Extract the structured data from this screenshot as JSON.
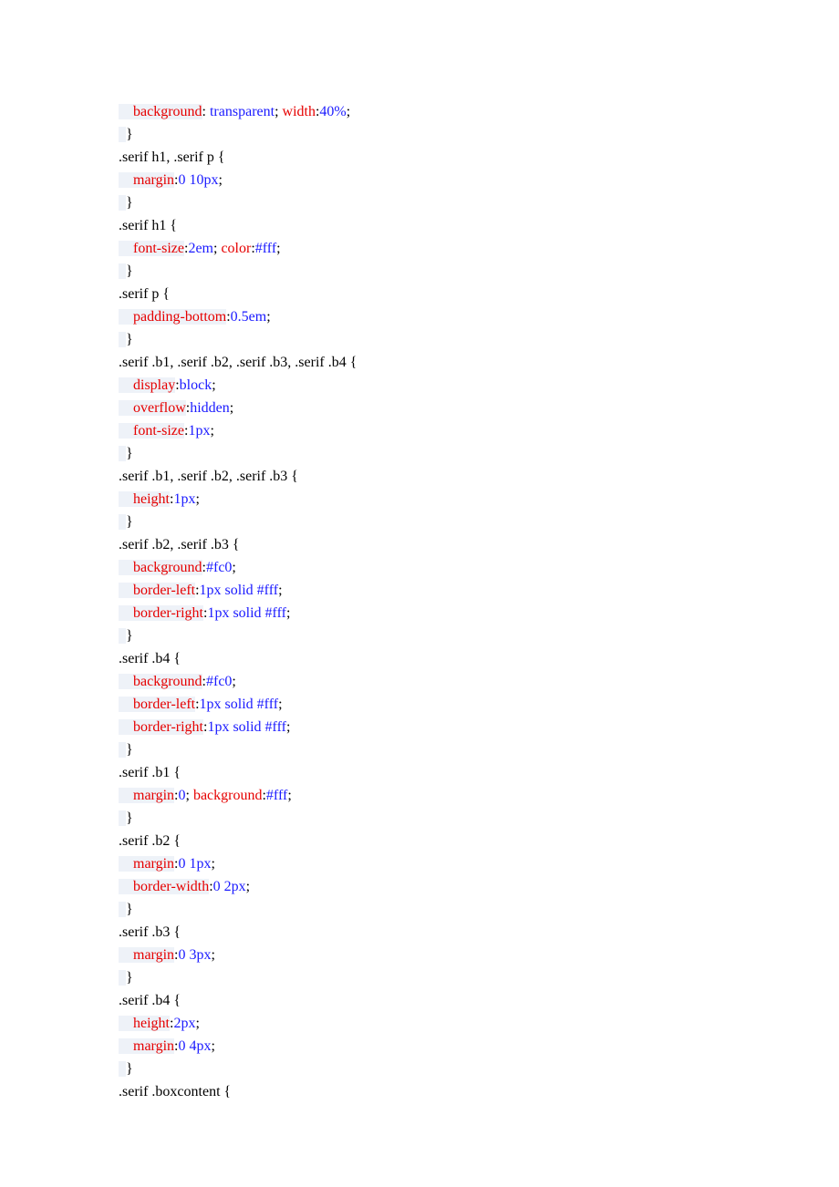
{
  "lines": [
    {
      "segments": [
        {
          "text": "    ",
          "cls": "hl"
        },
        {
          "text": "background",
          "cls": "hl prop"
        },
        {
          "text": ": ",
          "cls": "colon"
        },
        {
          "text": "transparent",
          "cls": "val"
        },
        {
          "text": "; ",
          "cls": "punct"
        },
        {
          "text": "width",
          "cls": "prop"
        },
        {
          "text": ":",
          "cls": "colon"
        },
        {
          "text": "40%",
          "cls": "val"
        },
        {
          "text": ";",
          "cls": "punct"
        }
      ]
    },
    {
      "segments": [
        {
          "text": "  ",
          "cls": "hl"
        },
        {
          "text": "}",
          "cls": "punct"
        }
      ]
    },
    {
      "segments": [
        {
          "text": ".serif h1, .serif p {",
          "cls": "sel"
        }
      ]
    },
    {
      "segments": [
        {
          "text": "    ",
          "cls": "hl"
        },
        {
          "text": "margin",
          "cls": "hl prop"
        },
        {
          "text": ":",
          "cls": "colon"
        },
        {
          "text": "0 10px",
          "cls": "val"
        },
        {
          "text": ";",
          "cls": "punct"
        }
      ]
    },
    {
      "segments": [
        {
          "text": "  ",
          "cls": "hl"
        },
        {
          "text": "}",
          "cls": "punct"
        }
      ]
    },
    {
      "segments": [
        {
          "text": ".serif h1 {",
          "cls": "sel"
        }
      ]
    },
    {
      "segments": [
        {
          "text": "    ",
          "cls": "hl"
        },
        {
          "text": "font-size",
          "cls": "hl prop"
        },
        {
          "text": ":",
          "cls": "colon"
        },
        {
          "text": "2em",
          "cls": "val"
        },
        {
          "text": "; ",
          "cls": "punct"
        },
        {
          "text": "color",
          "cls": "prop"
        },
        {
          "text": ":",
          "cls": "colon"
        },
        {
          "text": "#fff",
          "cls": "val"
        },
        {
          "text": ";",
          "cls": "punct"
        }
      ]
    },
    {
      "segments": [
        {
          "text": "  ",
          "cls": "hl"
        },
        {
          "text": "}",
          "cls": "punct"
        }
      ]
    },
    {
      "segments": [
        {
          "text": ".serif p {",
          "cls": "sel"
        }
      ]
    },
    {
      "segments": [
        {
          "text": "    ",
          "cls": "hl"
        },
        {
          "text": "padding-bottom",
          "cls": "hl prop"
        },
        {
          "text": ":",
          "cls": "colon"
        },
        {
          "text": "0.5em",
          "cls": "val"
        },
        {
          "text": ";",
          "cls": "punct"
        }
      ]
    },
    {
      "segments": [
        {
          "text": "  ",
          "cls": "hl"
        },
        {
          "text": "}",
          "cls": "punct"
        }
      ]
    },
    {
      "segments": [
        {
          "text": ".serif .b1, .serif .b2, .serif .b3, .serif .b4 {",
          "cls": "sel"
        }
      ]
    },
    {
      "segments": [
        {
          "text": "    ",
          "cls": "hl"
        },
        {
          "text": "display",
          "cls": "hl prop"
        },
        {
          "text": ":",
          "cls": "colon"
        },
        {
          "text": "block",
          "cls": "val"
        },
        {
          "text": ";",
          "cls": "punct"
        }
      ]
    },
    {
      "segments": [
        {
          "text": "    ",
          "cls": "hl"
        },
        {
          "text": "overflow",
          "cls": "hl prop"
        },
        {
          "text": ":",
          "cls": "colon"
        },
        {
          "text": "hidden",
          "cls": "val"
        },
        {
          "text": ";",
          "cls": "punct"
        }
      ]
    },
    {
      "segments": [
        {
          "text": "    ",
          "cls": "hl"
        },
        {
          "text": "font-size",
          "cls": "hl prop"
        },
        {
          "text": ":",
          "cls": "colon"
        },
        {
          "text": "1px",
          "cls": "val"
        },
        {
          "text": ";",
          "cls": "punct"
        }
      ]
    },
    {
      "segments": [
        {
          "text": "  ",
          "cls": "hl"
        },
        {
          "text": "}",
          "cls": "punct"
        }
      ]
    },
    {
      "segments": [
        {
          "text": ".serif .b1, .serif .b2, .serif .b3 {",
          "cls": "sel"
        }
      ]
    },
    {
      "segments": [
        {
          "text": "    ",
          "cls": "hl"
        },
        {
          "text": "height",
          "cls": "hl prop"
        },
        {
          "text": ":",
          "cls": "colon"
        },
        {
          "text": "1px",
          "cls": "val"
        },
        {
          "text": ";",
          "cls": "punct"
        }
      ]
    },
    {
      "segments": [
        {
          "text": "  ",
          "cls": "hl"
        },
        {
          "text": "}",
          "cls": "punct"
        }
      ]
    },
    {
      "segments": [
        {
          "text": ".serif .b2, .serif .b3 {",
          "cls": "sel"
        }
      ]
    },
    {
      "segments": [
        {
          "text": "    ",
          "cls": "hl"
        },
        {
          "text": "background",
          "cls": "hl prop"
        },
        {
          "text": ":",
          "cls": "colon"
        },
        {
          "text": "#fc0",
          "cls": "val"
        },
        {
          "text": ";",
          "cls": "punct"
        }
      ]
    },
    {
      "segments": [
        {
          "text": "    ",
          "cls": "hl"
        },
        {
          "text": "border-left",
          "cls": "hl prop"
        },
        {
          "text": ":",
          "cls": "colon"
        },
        {
          "text": "1px solid #fff",
          "cls": "val"
        },
        {
          "text": ";",
          "cls": "punct"
        }
      ]
    },
    {
      "segments": [
        {
          "text": "    ",
          "cls": "hl"
        },
        {
          "text": "border-right",
          "cls": "hl prop"
        },
        {
          "text": ":",
          "cls": "colon"
        },
        {
          "text": "1px solid #fff",
          "cls": "val"
        },
        {
          "text": ";",
          "cls": "punct"
        }
      ]
    },
    {
      "segments": [
        {
          "text": "  ",
          "cls": "hl"
        },
        {
          "text": "}",
          "cls": "punct"
        }
      ]
    },
    {
      "segments": [
        {
          "text": ".serif .b4 {",
          "cls": "sel"
        }
      ]
    },
    {
      "segments": [
        {
          "text": "    ",
          "cls": "hl"
        },
        {
          "text": "background",
          "cls": "hl prop"
        },
        {
          "text": ":",
          "cls": "colon"
        },
        {
          "text": "#fc0",
          "cls": "val"
        },
        {
          "text": ";",
          "cls": "punct"
        }
      ]
    },
    {
      "segments": [
        {
          "text": "    ",
          "cls": "hl"
        },
        {
          "text": "border-left",
          "cls": "hl prop"
        },
        {
          "text": ":",
          "cls": "colon"
        },
        {
          "text": "1px solid #fff",
          "cls": "val"
        },
        {
          "text": ";",
          "cls": "punct"
        }
      ]
    },
    {
      "segments": [
        {
          "text": "    ",
          "cls": "hl"
        },
        {
          "text": "border-right",
          "cls": "hl prop"
        },
        {
          "text": ":",
          "cls": "colon"
        },
        {
          "text": "1px solid #fff",
          "cls": "val"
        },
        {
          "text": ";",
          "cls": "punct"
        }
      ]
    },
    {
      "segments": [
        {
          "text": "  ",
          "cls": "hl"
        },
        {
          "text": "}",
          "cls": "punct"
        }
      ]
    },
    {
      "segments": [
        {
          "text": ".serif .b1 {",
          "cls": "sel"
        }
      ]
    },
    {
      "segments": [
        {
          "text": "    ",
          "cls": "hl"
        },
        {
          "text": "margin",
          "cls": "hl prop"
        },
        {
          "text": ":",
          "cls": "colon"
        },
        {
          "text": "0",
          "cls": "val"
        },
        {
          "text": "; ",
          "cls": "punct"
        },
        {
          "text": "background",
          "cls": "prop"
        },
        {
          "text": ":",
          "cls": "colon"
        },
        {
          "text": "#fff",
          "cls": "val"
        },
        {
          "text": ";",
          "cls": "punct"
        }
      ]
    },
    {
      "segments": [
        {
          "text": "  ",
          "cls": "hl"
        },
        {
          "text": "}",
          "cls": "punct"
        }
      ]
    },
    {
      "segments": [
        {
          "text": ".serif .b2 {",
          "cls": "sel"
        }
      ]
    },
    {
      "segments": [
        {
          "text": "    ",
          "cls": "hl"
        },
        {
          "text": "margin",
          "cls": "hl prop"
        },
        {
          "text": ":",
          "cls": "colon"
        },
        {
          "text": "0 1px",
          "cls": "val"
        },
        {
          "text": ";",
          "cls": "punct"
        }
      ]
    },
    {
      "segments": [
        {
          "text": "    ",
          "cls": "hl"
        },
        {
          "text": "border-width",
          "cls": "hl prop"
        },
        {
          "text": ":",
          "cls": "colon"
        },
        {
          "text": "0 2px",
          "cls": "val"
        },
        {
          "text": ";",
          "cls": "punct"
        }
      ]
    },
    {
      "segments": [
        {
          "text": "  ",
          "cls": "hl"
        },
        {
          "text": "}",
          "cls": "punct"
        }
      ]
    },
    {
      "segments": [
        {
          "text": ".serif .b3 {",
          "cls": "sel"
        }
      ]
    },
    {
      "segments": [
        {
          "text": "    ",
          "cls": "hl"
        },
        {
          "text": "margin",
          "cls": "hl prop"
        },
        {
          "text": ":",
          "cls": "colon"
        },
        {
          "text": "0 3px",
          "cls": "val"
        },
        {
          "text": ";",
          "cls": "punct"
        }
      ]
    },
    {
      "segments": [
        {
          "text": "  ",
          "cls": "hl"
        },
        {
          "text": "}",
          "cls": "punct"
        }
      ]
    },
    {
      "segments": [
        {
          "text": ".serif .b4 {",
          "cls": "sel"
        }
      ]
    },
    {
      "segments": [
        {
          "text": "    ",
          "cls": "hl"
        },
        {
          "text": "height",
          "cls": "hl prop"
        },
        {
          "text": ":",
          "cls": "colon"
        },
        {
          "text": "2px",
          "cls": "val"
        },
        {
          "text": ";",
          "cls": "punct"
        }
      ]
    },
    {
      "segments": [
        {
          "text": "    ",
          "cls": "hl"
        },
        {
          "text": "margin",
          "cls": "hl prop"
        },
        {
          "text": ":",
          "cls": "colon"
        },
        {
          "text": "0 4px",
          "cls": "val"
        },
        {
          "text": ";",
          "cls": "punct"
        }
      ]
    },
    {
      "segments": [
        {
          "text": "  ",
          "cls": "hl"
        },
        {
          "text": "}",
          "cls": "punct"
        }
      ]
    },
    {
      "segments": [
        {
          "text": ".serif .boxcontent {",
          "cls": "sel"
        }
      ]
    }
  ]
}
